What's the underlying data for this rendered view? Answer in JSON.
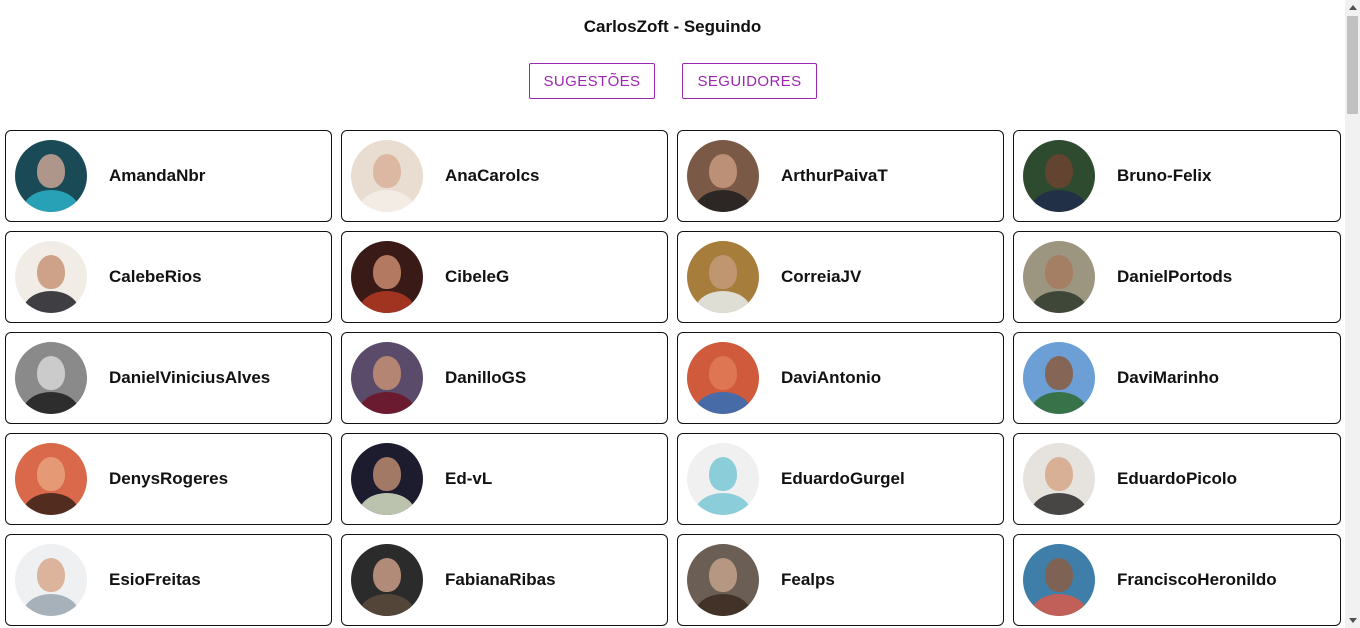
{
  "header": {
    "title": "CarlosZoft - Seguindo"
  },
  "buttons": {
    "suggestions_label": "SUGESTÕES",
    "followers_label": "SEGUIDORES"
  },
  "theme": {
    "accent": "#9c27b0"
  },
  "users": [
    {
      "name": "AmandaNbr",
      "bg": "#1b4a57",
      "face": "#c9a394",
      "body": "#2ab0c8"
    },
    {
      "name": "AnaCarolcs",
      "bg": "#e9ddd2",
      "face": "#d9b29b",
      "body": "#f4efe9"
    },
    {
      "name": "ArthurPaivaT",
      "bg": "#7a5a47",
      "face": "#c89a80",
      "body": "#1f1f1f"
    },
    {
      "name": "Bruno-Felix",
      "bg": "#2e4a2f",
      "face": "#6b4330",
      "body": "#1f2c4a"
    },
    {
      "name": "CalebeRios",
      "bg": "#f1ede6",
      "face": "#c79478",
      "body": "#1e1e26"
    },
    {
      "name": "CibeleG",
      "bg": "#3a1a17",
      "face": "#c98c6e",
      "body": "#b33a22"
    },
    {
      "name": "CorreiaJV",
      "bg": "#a77d3c",
      "face": "#c39a79",
      "body": "#e8eef0"
    },
    {
      "name": "DanielPortods",
      "bg": "#9c9580",
      "face": "#a67b5e",
      "body": "#2f3a2c"
    },
    {
      "name": "DanielViniciusAlves",
      "bg": "#8a8a8a",
      "face": "#d6d6d6",
      "body": "#1c1c1c"
    },
    {
      "name": "DanilloGS",
      "bg": "#5b4b6b",
      "face": "#c48f73",
      "body": "#6e1326"
    },
    {
      "name": "DaviAntonio",
      "bg": "#cf5a3c",
      "face": "#e07b58",
      "body": "#2e6fb8"
    },
    {
      "name": "DaviMarinho",
      "bg": "#6b9fd6",
      "face": "#8a5a3e",
      "body": "#2f6a2f"
    },
    {
      "name": "DenysRogeres",
      "bg": "#d9694a",
      "face": "#e8a27c",
      "body": "#3a2218"
    },
    {
      "name": "Ed-vL",
      "bg": "#1d1b2e",
      "face": "#b88a6f",
      "body": "#d7e0c5"
    },
    {
      "name": "EduardoGurgel",
      "bg": "#f0f0f0",
      "face": "#7ac7d6",
      "body": "#7ac7d6"
    },
    {
      "name": "EduardoPicolo",
      "bg": "#e6e2de",
      "face": "#d4a78a",
      "body": "#2a2a2a"
    },
    {
      "name": "EsioFreitas",
      "bg": "#eef0f2",
      "face": "#d8a98c",
      "body": "#9aa6b0"
    },
    {
      "name": "FabianaRibas",
      "bg": "#2b2b2b",
      "face": "#c99c86",
      "body": "#5a4a3a"
    },
    {
      "name": "Fealps",
      "bg": "#6b5f55",
      "face": "#c3a18b",
      "body": "#3b2a20"
    },
    {
      "name": "FranciscoHeronildo",
      "bg": "#3f7ea8",
      "face": "#8a5e46",
      "body": "#d85a4a"
    }
  ]
}
